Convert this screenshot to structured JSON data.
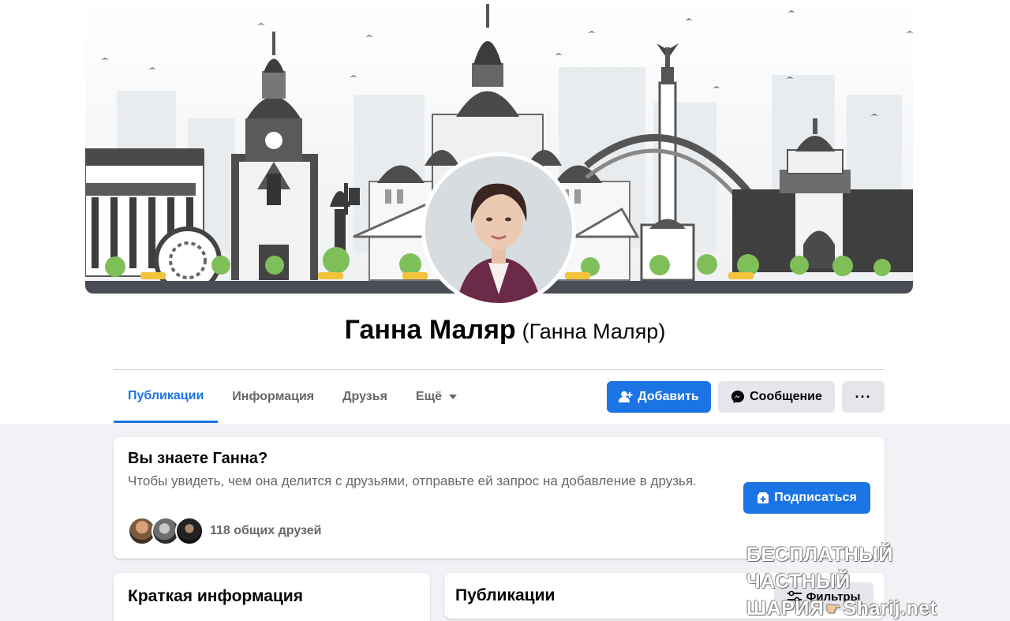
{
  "profile": {
    "name": "Ганна Маляр",
    "alternate_name": "(Ганна Маляр)"
  },
  "tabs": [
    {
      "label": "Публикации",
      "active": true
    },
    {
      "label": "Информация",
      "active": false
    },
    {
      "label": "Друзья",
      "active": false
    },
    {
      "label": "Ещё",
      "active": false
    }
  ],
  "actions": {
    "add_label": "Добавить",
    "message_label": "Сообщение",
    "more_label": "···"
  },
  "know_card": {
    "title": "Вы знаете Ганна?",
    "text": "Чтобы увидеть, чем она делится с друзьями, отправьте ей запрос на добавление в друзья.",
    "subscribe_label": "Подписаться",
    "mutual_friends": "118 общих друзей"
  },
  "brief_card": {
    "title": "Краткая информация"
  },
  "posts_card": {
    "title": "Публикации",
    "filters_label": "Фильтры"
  },
  "watermark": {
    "line1": "БЕСПЛАТНЫЙ ЧАСТНЫЙ",
    "line2_left": "ШАРИЯ",
    "line2_right": "Sharij.net"
  },
  "colors": {
    "accent": "#1b74e4",
    "secondary_button": "#e4e6eb",
    "page_bg": "#f0f2f5",
    "muted_text": "#65676b"
  }
}
